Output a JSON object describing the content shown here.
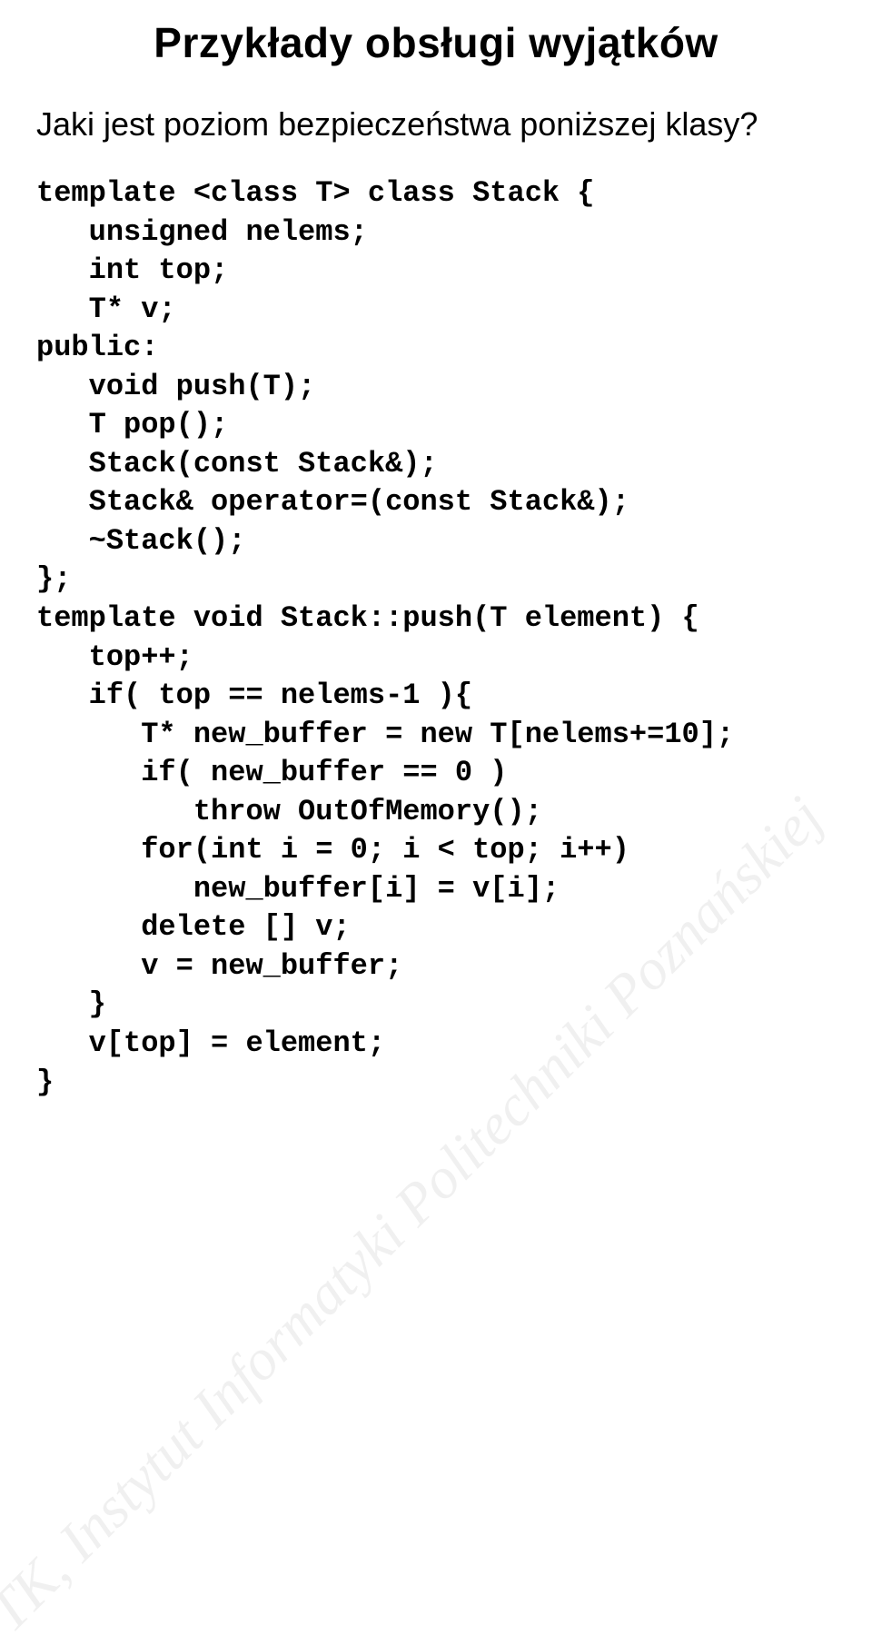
{
  "title": "Przykłady obsługi wyjątków",
  "subtitle": "Jaki jest poziom bezpieczeństwa poniższej klasy?",
  "code": "template <class T> class Stack {\n   unsigned nelems;\n   int top;\n   T* v;\npublic:\n   void push(T);\n   T pop();\n   Stack(const Stack&);\n   Stack& operator=(const Stack&);\n   ~Stack();\n};\ntemplate void Stack::push(T element) {\n   top++;\n   if( top == nelems-1 ){\n      T* new_buffer = new T[nelems+=10];\n      if( new_buffer == 0 )\n         throw OutOfMemory();\n      for(int i = 0; i < top; i++)\n         new_buffer[i] = v[i];\n      delete [] v;\n      v = new_buffer;\n   }\n   v[top] = element;\n}",
  "watermark": "TK, Instytut Informatyki Politechniki Poznańskiej"
}
